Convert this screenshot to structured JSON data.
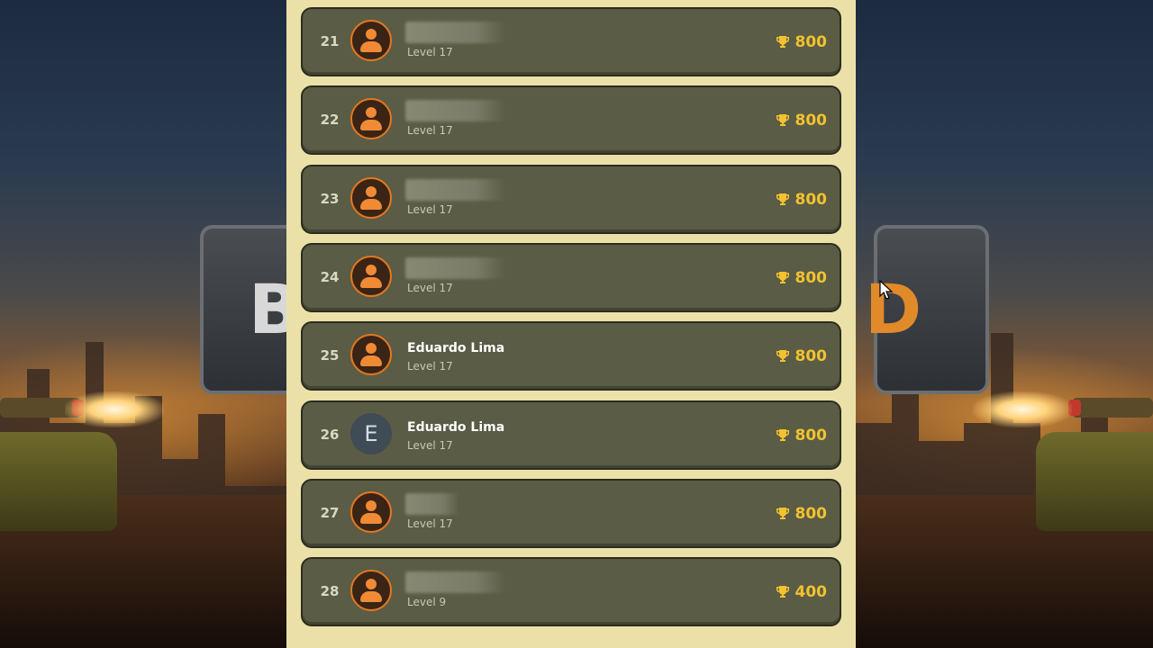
{
  "leaderboard": {
    "rows": [
      {
        "rank": "21",
        "name": "",
        "name_hidden": true,
        "level": "Level 17",
        "score": "800",
        "avatar": "person-icon"
      },
      {
        "rank": "22",
        "name": "",
        "name_hidden": true,
        "level": "Level 17",
        "score": "800",
        "avatar": "person-icon"
      },
      {
        "rank": "23",
        "name": "",
        "name_hidden": true,
        "level": "Level 17",
        "score": "800",
        "avatar": "person-icon"
      },
      {
        "rank": "24",
        "name": "",
        "name_hidden": true,
        "level": "Level 17",
        "score": "800",
        "avatar": "person-icon"
      },
      {
        "rank": "25",
        "name": "Eduardo Lima",
        "name_hidden": false,
        "level": "Level 17",
        "score": "800",
        "avatar": "person-icon"
      },
      {
        "rank": "26",
        "name": "Eduardo Lima",
        "name_hidden": false,
        "level": "Level 17",
        "score": "800",
        "avatar": "letter",
        "avatar_letter": "E"
      },
      {
        "rank": "27",
        "name": "",
        "name_hidden": true,
        "level": "Level 17",
        "score": "800",
        "avatar": "person-icon"
      },
      {
        "rank": "28",
        "name": "",
        "name_hidden": true,
        "level": "Level 9",
        "score": "400",
        "avatar": "person-icon"
      }
    ]
  },
  "icons": {
    "score": "trophy-icon",
    "avatar_default": "person-icon"
  },
  "colors": {
    "panel_bg": "#ebe1a8",
    "row_bg": "#5a5c45",
    "score": "#f2c230",
    "avatar_accent": "#f08a35"
  }
}
